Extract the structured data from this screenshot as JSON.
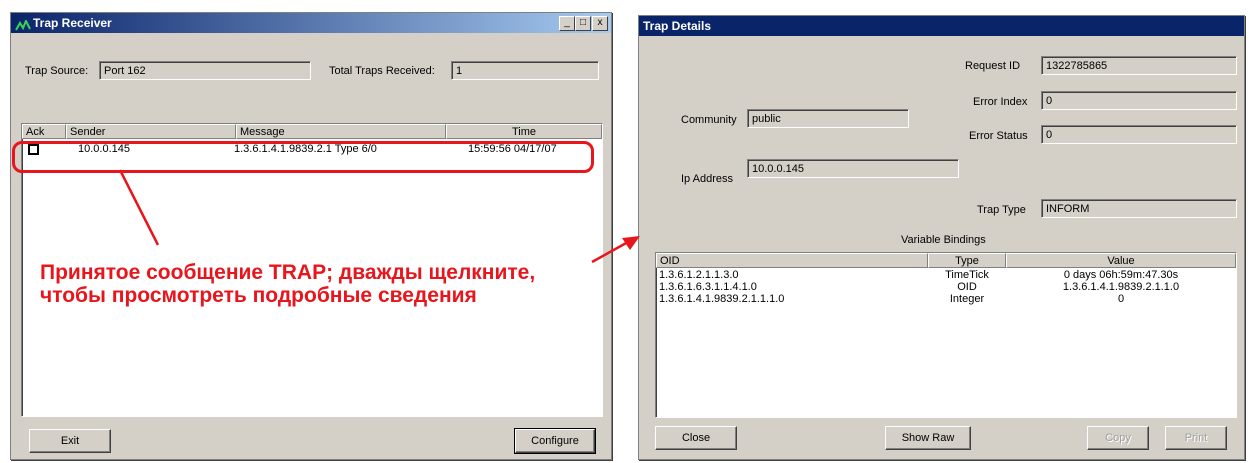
{
  "receiver": {
    "title": "Trap Receiver",
    "controls": {
      "minimize": "_",
      "maximize": "□",
      "close": "x"
    },
    "trap_source_label": "Trap Source:",
    "trap_source_value": "Port 162",
    "total_label": "Total Traps Received:",
    "total_value": "1",
    "columns": [
      "Ack",
      "Sender",
      "Message",
      "Time"
    ],
    "rows": [
      {
        "sender": "10.0.0.145",
        "message": "1.3.6.1.4.1.9839.2.1  Type 6/0",
        "time": "15:59:56 04/17/07"
      }
    ],
    "exit_label": "Exit",
    "configure_label": "Configure"
  },
  "annotation": {
    "line1": "Принятое сообщение TRAP; дважды щелкните,",
    "line2": "чтобы просмотреть подробные сведения",
    "color": "#e8161c"
  },
  "details": {
    "title": "Trap Details",
    "request_id_label": "Request ID",
    "request_id_value": "1322785865",
    "error_index_label": "Error Index",
    "error_index_value": "0",
    "error_status_label": "Error Status",
    "error_status_value": "0",
    "community_label": "Community",
    "community_value": "public",
    "ip_label": "Ip Address",
    "ip_value": "10.0.0.145",
    "trap_type_label": "Trap Type",
    "trap_type_value": "INFORM",
    "bindings_title": "Variable Bindings",
    "columns": [
      "OID",
      "Type",
      "Value"
    ],
    "rows": [
      {
        "oid": "1.3.6.1.2.1.1.3.0",
        "type": "TimeTick",
        "value": "0 days 06h:59m:47.30s"
      },
      {
        "oid": "1.3.6.1.6.3.1.1.4.1.0",
        "type": "OID",
        "value": "1.3.6.1.4.1.9839.2.1.1.0"
      },
      {
        "oid": "1.3.6.1.4.1.9839.2.1.1.1.0",
        "type": "Integer",
        "value": "0"
      }
    ],
    "close_label": "Close",
    "show_raw_label": "Show Raw",
    "copy_label": "Copy",
    "print_label": "Print"
  }
}
